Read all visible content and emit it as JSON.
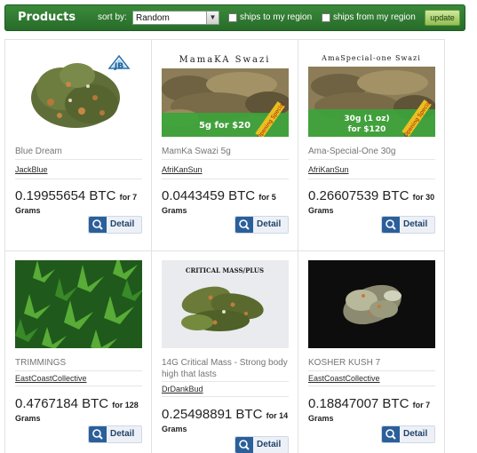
{
  "header": {
    "title": "Products",
    "sort_label": "sort by:",
    "sort_selected": "Random",
    "ships_to_label": "ships to my region",
    "ships_from_label": "ships from my region",
    "update_label": "update"
  },
  "products": [
    {
      "name": "Blue Dream",
      "vendor": "JackBlue",
      "price": "0.19955654 BTC",
      "unit": "for 7",
      "grams": "Grams",
      "detail_label": "Detail",
      "image": {
        "logo_text": "JB"
      }
    },
    {
      "name": "MamKa Swazi 5g",
      "vendor": "AfriKanSun",
      "price": "0.0443459 BTC",
      "unit": "for 5",
      "grams": "Grams",
      "detail_label": "Detail",
      "image": {
        "banner": "MamaKA Swazi",
        "offer": "5g for $20",
        "ribbon": "Opening Special"
      }
    },
    {
      "name": "Ama-Special-One 30g",
      "vendor": "AfriKanSun",
      "price": "0.26607539 BTC",
      "unit": "for 30",
      "grams": "Grams",
      "detail_label": "Detail",
      "image": {
        "banner": "AmaSpecial-one Swazi",
        "offer_line1": "30g (1 oz)",
        "offer_line2": "for $120",
        "ribbon": "Opening Special"
      }
    },
    {
      "name": "TRIMMINGS",
      "vendor": "EastCoastCollective",
      "price": "0.4767184 BTC",
      "unit": "for 128",
      "grams": "Grams",
      "detail_label": "Detail",
      "image": {}
    },
    {
      "name": "14G Critical Mass - Strong body high that lasts",
      "vendor": "DrDankBud",
      "price": "0.25498891 BTC",
      "unit": "for 14",
      "grams": "Grams",
      "detail_label": "Detail",
      "image": {
        "banner": "CRITICAL MASS/PLUS"
      }
    },
    {
      "name": "KOSHER KUSH 7",
      "vendor": "EastCoastCollective",
      "price": "0.18847007 BTC",
      "unit": "for 7",
      "grams": "Grams",
      "detail_label": "Detail",
      "image": {}
    }
  ],
  "colors": {
    "header_green": "#2f7a31",
    "button_blue": "#2b5f9a",
    "product_name_gray": "#757575"
  }
}
